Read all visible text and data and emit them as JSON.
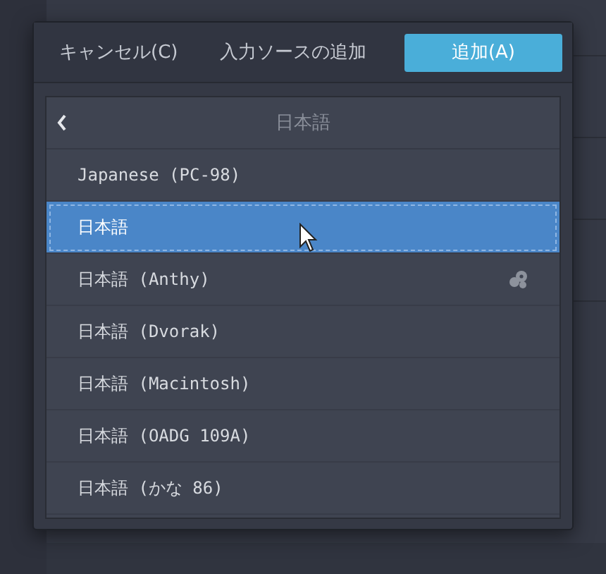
{
  "dialog": {
    "cancel": "キャンセル(C)",
    "title": "入力ソースの追加",
    "add": "追加(A)"
  },
  "list": {
    "back_title": "日本語",
    "items": [
      {
        "label": "Japanese (PC-98)",
        "selected": false,
        "has_settings": false
      },
      {
        "label": "日本語",
        "selected": true,
        "has_settings": false
      },
      {
        "label": "日本語 (Anthy)",
        "selected": false,
        "has_settings": true
      },
      {
        "label": "日本語 (Dvorak)",
        "selected": false,
        "has_settings": false
      },
      {
        "label": "日本語 (Macintosh)",
        "selected": false,
        "has_settings": false
      },
      {
        "label": "日本語 (OADG 109A)",
        "selected": false,
        "has_settings": false
      },
      {
        "label": "日本語 (かな 86)",
        "selected": false,
        "has_settings": false
      }
    ]
  }
}
